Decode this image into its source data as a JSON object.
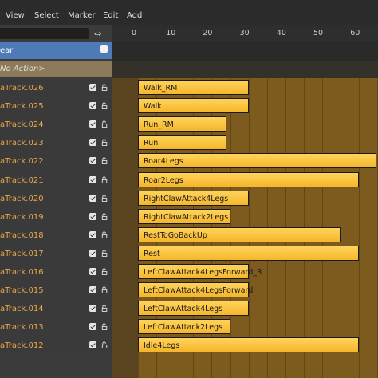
{
  "menu": {
    "view": "View",
    "select": "Select",
    "marker": "Marker",
    "edit": "Edit",
    "add": "Add"
  },
  "timeline": {
    "ticks": [
      "0",
      "10",
      "20",
      "30",
      "40",
      "50",
      "60"
    ]
  },
  "channels": {
    "object_label": "ear",
    "no_action_label": "No Action>"
  },
  "tracks": [
    {
      "name": "aTrack.026",
      "strip": "Walk_RM",
      "start": 0,
      "end": 30
    },
    {
      "name": "aTrack.025",
      "strip": "Walk",
      "start": 0,
      "end": 30
    },
    {
      "name": "aTrack.024",
      "strip": "Run_RM",
      "start": 0,
      "end": 24
    },
    {
      "name": "aTrack.023",
      "strip": "Run",
      "start": 0,
      "end": 24
    },
    {
      "name": "aTrack.022",
      "strip": "Roar4Legs",
      "start": 0,
      "end": 65
    },
    {
      "name": "aTrack.021",
      "strip": "Roar2Legs",
      "start": 0,
      "end": 60
    },
    {
      "name": "aTrack.020",
      "strip": "RightClawAttack4Legs",
      "start": 0,
      "end": 30
    },
    {
      "name": "aTrack.019",
      "strip": "RightClawAttack2Legs",
      "start": 0,
      "end": 25
    },
    {
      "name": "aTrack.018",
      "strip": "RestToGoBackUp",
      "start": 0,
      "end": 55
    },
    {
      "name": "aTrack.017",
      "strip": "Rest",
      "start": 0,
      "end": 60
    },
    {
      "name": "aTrack.016",
      "strip": "LeftClawAttack4LegsForward_R",
      "start": 0,
      "end": 30
    },
    {
      "name": "aTrack.015",
      "strip": "LeftClawAttack4LegsForward",
      "start": 0,
      "end": 30
    },
    {
      "name": "aTrack.014",
      "strip": "LeftClawAttack4Legs",
      "start": 0,
      "end": 30
    },
    {
      "name": "aTrack.013",
      "strip": "LeftClawAttack2Legs",
      "start": 0,
      "end": 25
    },
    {
      "name": "aTrack.012",
      "strip": "Idle4Legs",
      "start": 0,
      "end": 60
    }
  ]
}
